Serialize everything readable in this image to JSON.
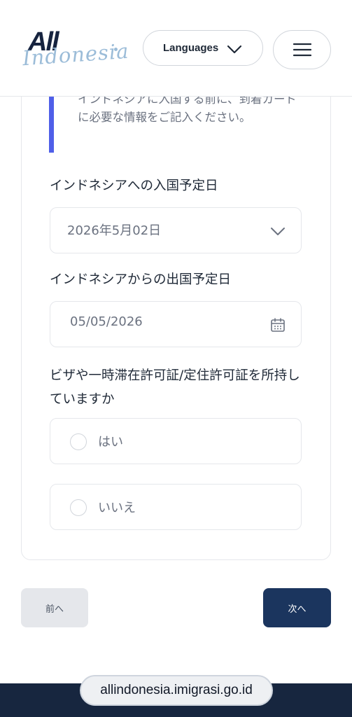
{
  "header": {
    "logo_primary": "All",
    "logo_secondary": "Indonesia",
    "language_button": "Languages",
    "menu_icon": "hamburger-menu-icon",
    "chevron_icon": "chevron-down-icon"
  },
  "form": {
    "notice_text": "インドネシアに入国する前に、到着カードに必要な情報をご記入ください。",
    "arrival": {
      "label": "インドネシアへの入国予定日",
      "value": "2026年5月02日",
      "icon": "chevron-down-icon"
    },
    "departure": {
      "label": "インドネシアからの出国予定日",
      "value": "05/05/2026",
      "icon": "calendar-icon"
    },
    "visa_question": {
      "label": "ビザや一時滞在許可証/定住許可証を所持していますか",
      "options": [
        {
          "label": "はい",
          "selected": false
        },
        {
          "label": "いいえ",
          "selected": false
        }
      ]
    }
  },
  "navigation": {
    "prev_label": "前へ",
    "next_label": "次へ"
  },
  "browser": {
    "url": "allindonesia.imigrasi.go.id"
  },
  "colors": {
    "accent_bar": "#4f5fe8",
    "primary_button": "#1b355e",
    "logo_dark": "#16233f",
    "logo_light": "#9bbcd8"
  }
}
